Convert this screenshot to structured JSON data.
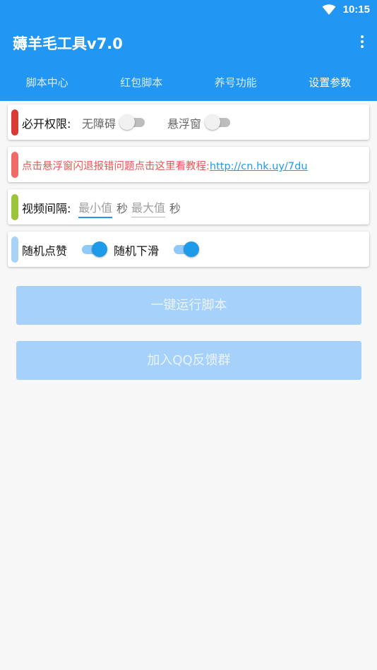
{
  "status_bar": {
    "time": "10:15",
    "wifi_icon": "wifi-icon"
  },
  "app_bar": {
    "title": "薅羊毛工具v7.0",
    "menu_icon": "more-vert-icon"
  },
  "tabs": [
    {
      "label": "脚本中心"
    },
    {
      "label": "红包脚本"
    },
    {
      "label": "养号功能"
    },
    {
      "label": "设置参数",
      "active": true
    }
  ],
  "permissions": {
    "label": "必开权限:",
    "accessibility_label": "无障碍",
    "accessibility_on": false,
    "float_label": "悬浮窗",
    "float_on": false,
    "accent": "#d93a35"
  },
  "notice": {
    "text": "点击悬浮窗闪退报错问题点击这里看教程:",
    "link": "http://cn.hk.uy/7du",
    "accent": "#f06a6a",
    "link_color": "#1e9be8"
  },
  "interval": {
    "label": "视频间隔:",
    "min_placeholder": "最小值",
    "min_unit": "秒",
    "max_placeholder": "最大值",
    "max_unit": "秒",
    "accent": "#9bc43a"
  },
  "random": {
    "like_label": "随机点赞",
    "like_on": true,
    "swipe_label": "随机下滑",
    "swipe_on": true,
    "accent": "#a8d3f7"
  },
  "buttons": {
    "run": "一键运行脚本",
    "join_qq": "加入QQ反馈群"
  },
  "colors": {
    "primary": "#2196f3",
    "button_disabled": "#a6d1fb"
  }
}
